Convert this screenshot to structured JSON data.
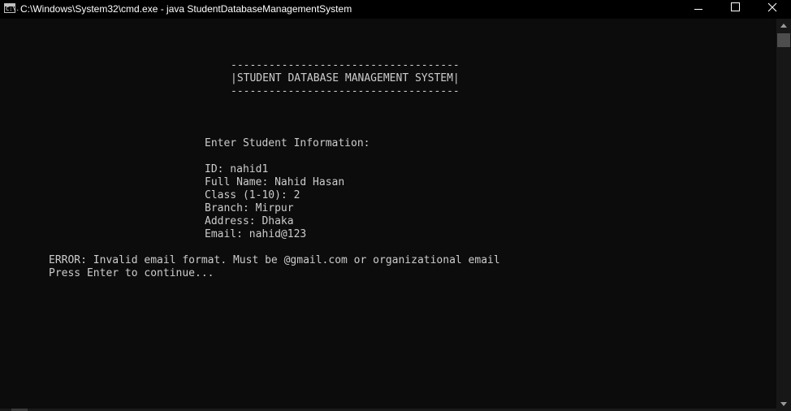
{
  "window": {
    "title": "C:\\Windows\\System32\\cmd.exe - java  StudentDatabaseManagementSystem",
    "app_icon": "cmd-icon",
    "app_icon_glyph": "C:\\.",
    "controls": [
      "minimize-icon",
      "maximize-icon",
      "close-icon"
    ]
  },
  "console": {
    "text_color": "#cccccc",
    "background": "#0c0c0c",
    "lines": {
      "banner_top": "------------------------------------",
      "banner_title": "|STUDENT DATABASE MANAGEMENT SYSTEM|",
      "banner_bottom": "------------------------------------",
      "prompt_heading": "Enter Student Information:",
      "id_line": "ID: nahid1",
      "full_name_line": "Full Name: Nahid Hasan",
      "class_line": "Class (1-10): 2",
      "branch_line": "Branch: Mirpur",
      "address_line": "Address: Dhaka",
      "email_line": "Email: nahid@123",
      "error_line": "ERROR: Invalid email format. Must be @gmail.com or organizational email",
      "continue_line": "Press Enter to continue..."
    }
  },
  "scrollbar": {
    "up_icon": "scroll-up-arrow-icon",
    "down_icon": "scroll-down-arrow-icon"
  }
}
